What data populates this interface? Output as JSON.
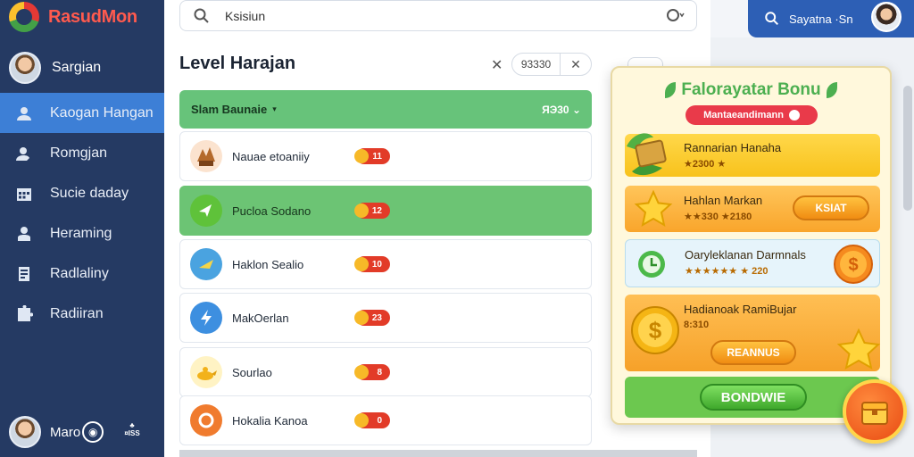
{
  "app": {
    "name": "RasudMon"
  },
  "sidebar": {
    "user_name": "Sargian",
    "items": [
      {
        "label": "Kaogan Hangan",
        "icon": "user-card-icon",
        "active": true
      },
      {
        "label": "Romgjan",
        "icon": "user-icon",
        "active": false
      },
      {
        "label": "Sucie daday",
        "icon": "calendar-icon",
        "active": false
      },
      {
        "label": "Heraming",
        "icon": "person-desk-icon",
        "active": false
      },
      {
        "label": "Radlaliny",
        "icon": "document-icon",
        "active": false
      },
      {
        "label": "Radiiran",
        "icon": "puzzle-icon",
        "active": false
      }
    ],
    "bottom_user": "Maro",
    "bottom_small": "¤ISS"
  },
  "search": {
    "text": "Ksisiun"
  },
  "main": {
    "title": "Level Harajan",
    "chip_value": "93330",
    "group_header": {
      "label": "Slam Baunaie",
      "right": "ЯЭ30"
    },
    "rows": [
      {
        "name": "Nauae etoaniiy",
        "badge": "11",
        "icon": "mushroom-house-icon",
        "highlight": false
      },
      {
        "name": "Pucloa Sodano",
        "badge": "12",
        "icon": "arrow-badge-icon",
        "highlight": true
      },
      {
        "name": "Haklon Sealio",
        "badge": "10",
        "icon": "wing-badge-icon",
        "highlight": false
      },
      {
        "name": "MakOerlan",
        "badge": "23",
        "icon": "bolt-badge-icon",
        "highlight": false
      },
      {
        "name": "Sourlao",
        "badge": "8",
        "icon": "genie-lamp-icon",
        "highlight": false
      },
      {
        "name": "Hokalia Kanoa",
        "badge": "0",
        "icon": "ring-badge-icon",
        "highlight": false
      }
    ]
  },
  "top_user": {
    "text": "Sayatna ·Sn"
  },
  "popup": {
    "title": "Falorayatar Bonu",
    "subtitle": "Mantaeandimann",
    "cards": [
      {
        "title": "Rannarian Hanaha",
        "meta": "★2300 ★",
        "icon": "leafy-box-icon"
      },
      {
        "title": "Hahlan Markan",
        "meta": "★★3З0 ★2180",
        "icon": "star-icon",
        "button": "KSIAT"
      },
      {
        "title": "Oaryleklanan Darmnals",
        "meta": "★★★★★★ ★ 220",
        "icon": "green-clock-icon"
      },
      {
        "title": "Hadianoak RamiBujar",
        "meta": "8:310",
        "icon": "gold-coin-icon",
        "button": "REANNUS"
      }
    ],
    "primary_button": "BONDWIE"
  },
  "colors": {
    "sidebar_bg": "#253a63",
    "sidebar_active": "#3d7fd6",
    "highlight_green": "#6cc474",
    "badge_red": "#e23b28",
    "popup_bg": "#fff8dc"
  }
}
